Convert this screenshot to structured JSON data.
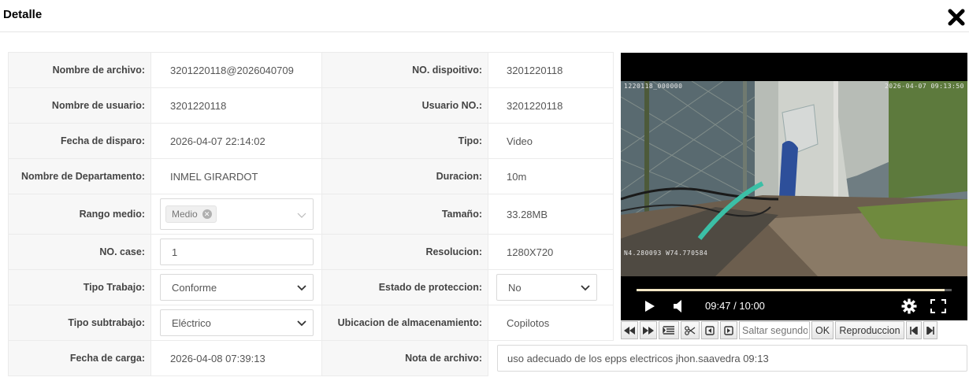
{
  "header": {
    "title": "Detalle",
    "close_icon": "close-icon"
  },
  "fields": {
    "nombre_archivo": {
      "label": "Nombre de archivo:",
      "value": "3201220118@2026040709"
    },
    "no_dispositivo": {
      "label": "NO. dispoitivo:",
      "value": "3201220118"
    },
    "nombre_usuario": {
      "label": "Nombre de usuario:",
      "value": "3201220118"
    },
    "usuario_no": {
      "label": "Usuario NO.:",
      "value": "3201220118"
    },
    "fecha_disparo": {
      "label": "Fecha de disparo:",
      "value": "2026-04-07 22:14:02"
    },
    "tipo": {
      "label": "Tipo:",
      "value": "Video"
    },
    "departamento": {
      "label": "Nombre de Departamento:",
      "value": "INMEL GIRARDOT"
    },
    "duracion": {
      "label": "Duracion:",
      "value": "10m"
    },
    "rango_medio": {
      "label": "Rango medio:",
      "tag": "Medio"
    },
    "tamano": {
      "label": "Tamaño:",
      "value": "33.28MB"
    },
    "no_case": {
      "label": "NO. case:",
      "value": "1"
    },
    "resolucion": {
      "label": "Resolucion:",
      "value": "1280X720"
    },
    "tipo_trabajo": {
      "label": "Tipo Trabajo:",
      "value": "Conforme"
    },
    "estado_proteccion": {
      "label": "Estado de proteccion:",
      "value": "No"
    },
    "tipo_subtrabajo": {
      "label": "Tipo subtrabajo:",
      "value": "Eléctrico"
    },
    "ubicacion": {
      "label": "Ubicacion de almacenamiento:",
      "value": "Copilotos"
    },
    "fecha_carga": {
      "label": "Fecha de carga:",
      "value": "2026-04-08 07:39:13"
    },
    "nota": {
      "label": "Nota de archivo:",
      "value": "uso adecuado de los epps electricos jhon.saavedra 09:13"
    }
  },
  "player": {
    "osd_top_left": "1220118_000000",
    "osd_top_right": "2026-04-07 09:13:50",
    "osd_bottom_left": "N4.280093 W74.770584",
    "time": "09:47 / 10:00",
    "progress": 0.978
  },
  "toolbar": {
    "skip_placeholder": "Saltar segundos",
    "ok_label": "OK",
    "play_label": "Reproduccion"
  },
  "colors": {
    "label_bg": "#f7f7f7",
    "border": "#ebebeb",
    "progress": "#f2e6c4"
  }
}
